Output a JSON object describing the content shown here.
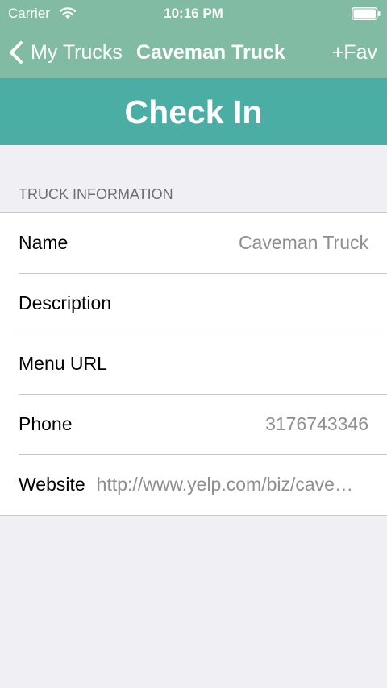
{
  "status_bar": {
    "carrier": "Carrier",
    "time": "10:16 PM"
  },
  "nav": {
    "back_label": "My Trucks",
    "title": "Caveman Truck",
    "fav_label": "+Fav"
  },
  "checkin_label": "Check In",
  "section": {
    "header": "TRUCK INFORMATION",
    "rows": [
      {
        "label": "Name",
        "value": "Caveman Truck"
      },
      {
        "label": "Description",
        "value": ""
      },
      {
        "label": "Menu URL",
        "value": ""
      },
      {
        "label": "Phone",
        "value": "3176743346"
      },
      {
        "label": "Website",
        "value": "http://www.yelp.com/biz/caveman-truck-indianapolis"
      }
    ]
  },
  "colors": {
    "nav_bar": "#81bba3",
    "checkin_button": "#4aaea4",
    "background": "#efeff4",
    "value_text": "#8e8e93"
  }
}
